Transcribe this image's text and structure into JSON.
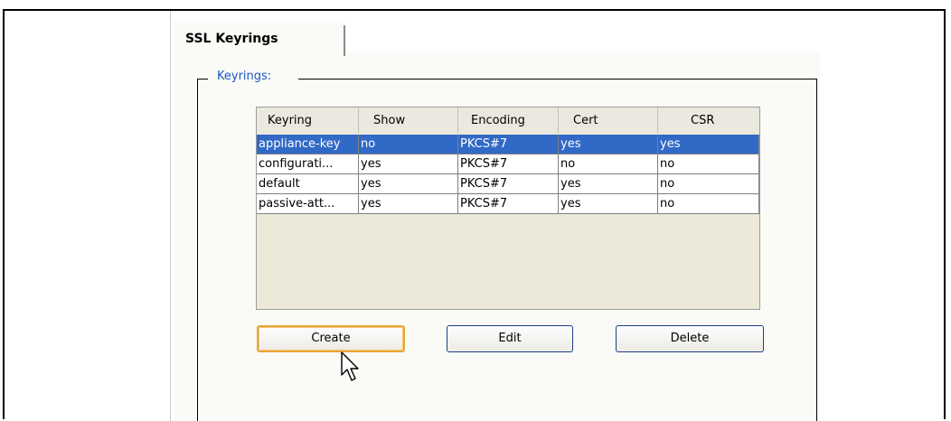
{
  "tab": {
    "label": "SSL Keyrings"
  },
  "group": {
    "legend": "Keyrings:"
  },
  "table": {
    "columns": [
      "Keyring",
      "Show",
      "Encoding",
      "Cert",
      "CSR"
    ],
    "rows": [
      [
        "appliance-key",
        "no",
        "PKCS#7",
        "yes",
        "yes"
      ],
      [
        "configurati...",
        "yes",
        "PKCS#7",
        "no",
        "no"
      ],
      [
        "default",
        "yes",
        "PKCS#7",
        "yes",
        "no"
      ],
      [
        "passive-att...",
        "yes",
        "PKCS#7",
        "yes",
        "no"
      ]
    ],
    "selected_row": 0
  },
  "buttons": {
    "create": "Create",
    "edit": "Edit",
    "delete": "Delete"
  },
  "colors": {
    "selection": "#3169c6",
    "legend": "#1f55c6",
    "focus": "#e7a63d"
  },
  "icons": {
    "cursor": "arrow-cursor-icon"
  }
}
